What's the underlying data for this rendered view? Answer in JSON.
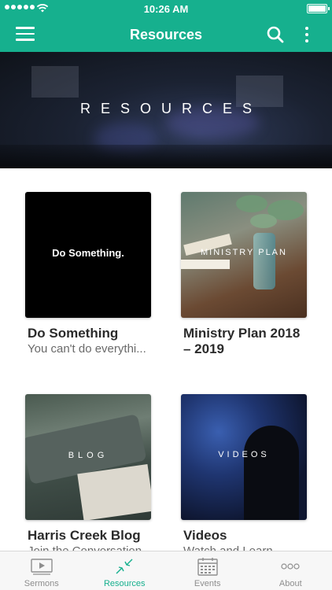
{
  "status_bar": {
    "time": "10:26 AM"
  },
  "header": {
    "title": "Resources"
  },
  "banner": {
    "title": "RESOURCES"
  },
  "cards": [
    {
      "thumb_text": "Do Something.",
      "title": "Do Something",
      "subtitle": "You can't do everythi..."
    },
    {
      "thumb_text": "MINISTRY PLAN",
      "title": "Ministry Plan 2018 – 2019",
      "subtitle": ""
    },
    {
      "thumb_text": "BLOG",
      "title": "Harris Creek Blog",
      "subtitle": "Join the Conversation"
    },
    {
      "thumb_text": "VIDEOS",
      "title": "Videos",
      "subtitle": "Watch and Learn"
    }
  ],
  "tabs": [
    {
      "label": "Sermons",
      "icon": "video-player-icon",
      "active": false
    },
    {
      "label": "Resources",
      "icon": "collapse-arrows-icon",
      "active": true
    },
    {
      "label": "Events",
      "icon": "calendar-icon",
      "active": false
    },
    {
      "label": "About",
      "icon": "more-dots-icon",
      "active": false
    }
  ],
  "colors": {
    "accent": "#16b08e",
    "inactive": "#8e8e8e",
    "text": "#2b2b2b",
    "subtext": "#6a6a6a"
  }
}
